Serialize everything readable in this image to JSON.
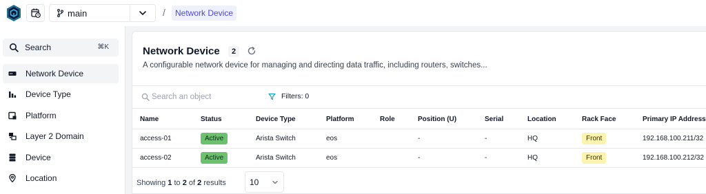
{
  "topbar": {
    "branch": "main",
    "breadcrumb_separator": "/",
    "breadcrumb": "Network Device"
  },
  "sidebar": {
    "search_label": "Search",
    "search_shortcut": "⌘K",
    "items": [
      {
        "label": "Network Device",
        "icon": "network-device-icon",
        "active": true
      },
      {
        "label": "Device Type",
        "icon": "bar-chart-icon",
        "active": false
      },
      {
        "label": "Platform",
        "icon": "platform-icon",
        "active": false
      },
      {
        "label": "Layer 2 Domain",
        "icon": "layer2-icon",
        "active": false
      },
      {
        "label": "Device",
        "icon": "database-icon",
        "active": false
      },
      {
        "label": "Location",
        "icon": "location-pin-icon",
        "active": false
      }
    ]
  },
  "main": {
    "title": "Network Device",
    "count": "2",
    "description": "A configurable network device for managing and directing data traffic, including routers, switches...",
    "search_placeholder": "Search an object",
    "filters_label": "Filters: 0",
    "columns": [
      "Name",
      "Status",
      "Device Type",
      "Platform",
      "Role",
      "Position (U)",
      "Serial",
      "Location",
      "Rack Face",
      "Primary IP Address"
    ],
    "rows": [
      {
        "name": "access-01",
        "status": "Active",
        "device_type": "Arista Switch",
        "platform": "eos",
        "role": "",
        "position": "-",
        "serial": "-",
        "location": "HQ",
        "rack_face": "Front",
        "primary_ip": "192.168.100.211/32"
      },
      {
        "name": "access-02",
        "status": "Active",
        "device_type": "Arista Switch",
        "platform": "eos",
        "role": "",
        "position": "-",
        "serial": "-",
        "location": "HQ",
        "rack_face": "Front",
        "primary_ip": "192.168.100.212/32"
      }
    ],
    "pagination": {
      "prefix": "Showing",
      "from": "1",
      "to_word": "to",
      "to": "2",
      "of_word": "of",
      "total": "2",
      "suffix": "results",
      "page_size": "10"
    }
  },
  "colors": {
    "accent": "#4f46e5",
    "status_active": "#6cc070",
    "rack_front": "#fbf3b0"
  }
}
